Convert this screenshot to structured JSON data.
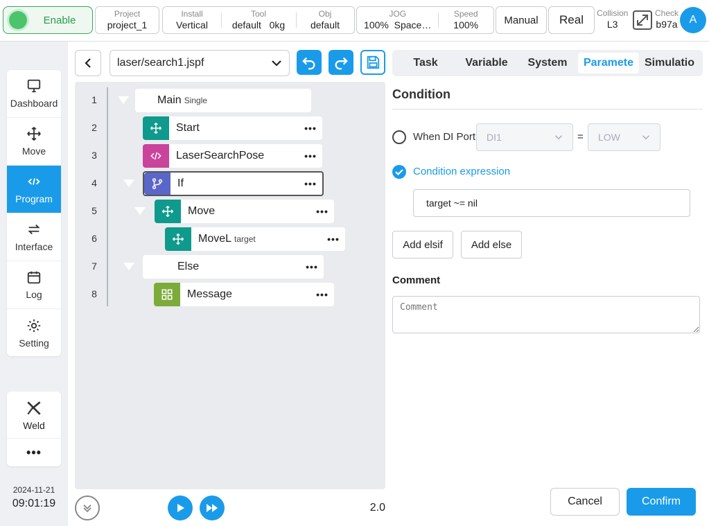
{
  "status": {
    "enable": "Enable"
  },
  "toolbar": {
    "project": {
      "caption": "Project",
      "value": "project_1"
    },
    "install": {
      "caption": "Install",
      "value": "Vertical"
    },
    "tool": {
      "caption": "Tool",
      "value": "default",
      "payload": "0kg"
    },
    "obj": {
      "caption": "Obj",
      "value": "default"
    },
    "jog": {
      "caption": "JOG",
      "value": "100%",
      "frame": "Space…"
    },
    "speed": {
      "caption": "Speed",
      "value": "100%"
    },
    "mode": "Manual",
    "env": "Real",
    "collision": {
      "caption": "Collision",
      "value": "L3"
    },
    "check": {
      "caption": "Check",
      "value": "b97a"
    },
    "avatar": "A"
  },
  "nav": {
    "items": [
      {
        "label": "Dashboard",
        "icon": "monitor-icon"
      },
      {
        "label": "Move",
        "icon": "move-icon"
      },
      {
        "label": "Program",
        "icon": "code-icon"
      },
      {
        "label": "Interface",
        "icon": "swap-icon"
      },
      {
        "label": "Log",
        "icon": "calendar-icon"
      },
      {
        "label": "Setting",
        "icon": "gear-icon"
      }
    ],
    "weld": "Weld",
    "more": "•••"
  },
  "clock": {
    "date": "2024-11-21",
    "time": "09:01:19"
  },
  "editor": {
    "file": "laser/search1.jspf",
    "lines": [
      {
        "num": "1",
        "label": "Main",
        "sub": "Single"
      },
      {
        "num": "2",
        "label": "Start"
      },
      {
        "num": "3",
        "label": "LaserSearchPose"
      },
      {
        "num": "4",
        "label": "If"
      },
      {
        "num": "5",
        "label": "Move"
      },
      {
        "num": "6",
        "label": "MoveL",
        "sub": "target"
      },
      {
        "num": "7",
        "label": "Else"
      },
      {
        "num": "8",
        "label": "Message"
      }
    ],
    "speed": "2.0"
  },
  "tabs": [
    "Task",
    "Variable",
    "System",
    "Paramete",
    "Simulatio"
  ],
  "panel": {
    "title": "Condition",
    "di_label": "When DI Port",
    "di_port": "DI1",
    "equals": "=",
    "di_level": "LOW",
    "expr_label": "Condition expression",
    "expr_value": "target ~= nil",
    "add_elsif": "Add elsif",
    "add_else": "Add else",
    "comment_label": "Comment",
    "comment_placeholder": "Comment",
    "cancel": "Cancel",
    "confirm": "Confirm"
  },
  "colors": {
    "accent": "#1a9bea",
    "teal": "#0e9a8c",
    "pink": "#c9449a",
    "indigo": "#5a66c8",
    "green": "#7cab3a"
  }
}
